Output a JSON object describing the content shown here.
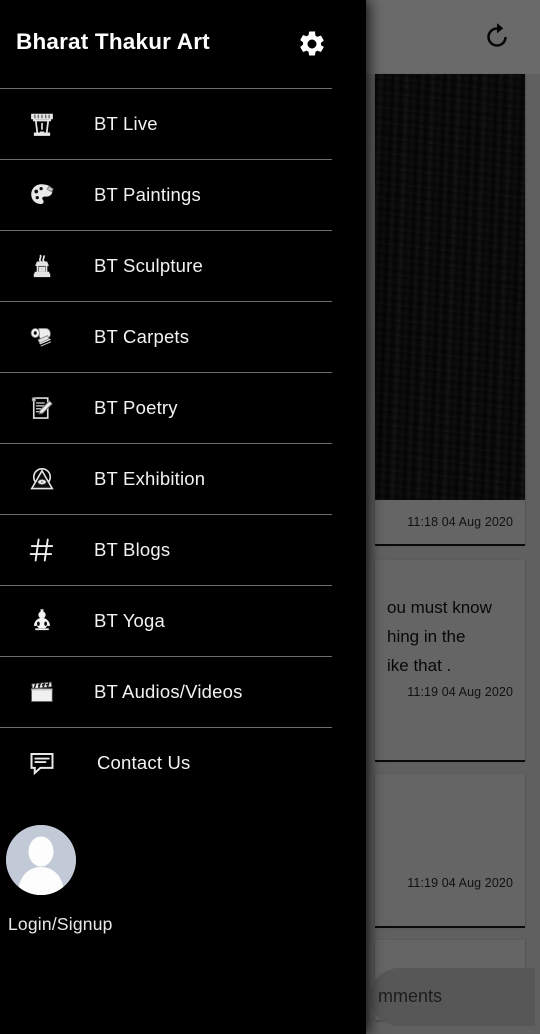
{
  "drawer": {
    "title": "Bharat Thakur Art",
    "settings_icon": "gear-icon",
    "items": [
      {
        "label": "BT Live",
        "icon": "stage-podium-icon"
      },
      {
        "label": "BT Paintings",
        "icon": "paint-palette-icon"
      },
      {
        "label": "BT Sculpture",
        "icon": "sculpture-icon"
      },
      {
        "label": "BT Carpets",
        "icon": "carpet-roll-icon"
      },
      {
        "label": "BT Poetry",
        "icon": "scroll-pen-icon"
      },
      {
        "label": "BT Exhibition",
        "icon": "eye-pyramid-icon"
      },
      {
        "label": "BT Blogs",
        "icon": "hash-icon"
      },
      {
        "label": "BT Yoga",
        "icon": "meditation-figure-icon"
      },
      {
        "label": "BT Audios/Videos",
        "icon": "clapperboard-icon"
      },
      {
        "label": "Contact Us",
        "icon": "chat-bubble-icon"
      }
    ],
    "account": {
      "label": "Login/Signup",
      "avatar_icon": "user-avatar-icon",
      "avatar_bg": "#c3cad7"
    }
  },
  "content": {
    "app_bar": {
      "refresh_icon": "refresh-icon"
    },
    "posts": [
      {
        "text_lines": [],
        "timestamp": "11:18 04 Aug 2020",
        "has_photo": true
      },
      {
        "text_lines": [
          "ou must know",
          "hing in the",
          "ike that ."
        ],
        "timestamp": "11:19 04 Aug 2020",
        "has_photo": false
      },
      {
        "text_lines": [],
        "timestamp": "11:19 04 Aug 2020",
        "has_photo": false
      }
    ],
    "comments_label": "mments"
  },
  "colors": {
    "drawer_bg": "#000000",
    "drawer_text": "#f2f2f2",
    "divider": "#6e6e6e",
    "content_bg": "#9b9b9b",
    "app_bar_bg": "#ababab",
    "card_bg": "#a3a3a3"
  }
}
